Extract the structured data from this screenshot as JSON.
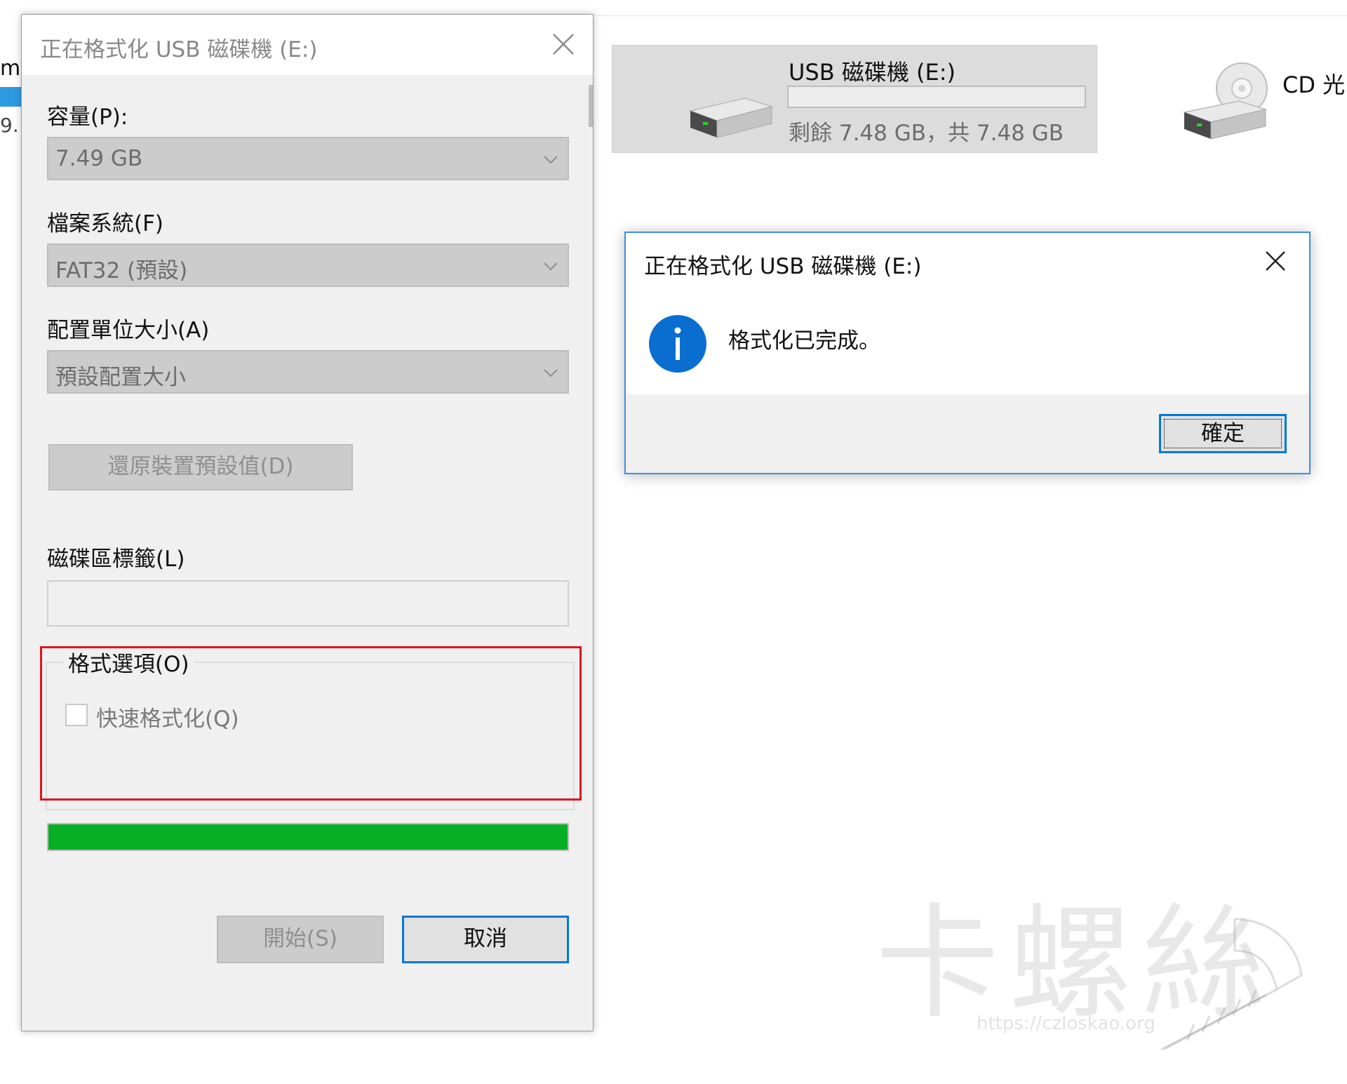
{
  "explorer": {
    "left_fragment_top": "m",
    "left_fragment_bottom": "9.",
    "usb_drive": {
      "name": "USB 磁碟機 (E:)",
      "space_text": "剩餘 7.48 GB，共 7.48 GB",
      "used_fraction": 0.0
    },
    "cd_drive": {
      "name": "CD 光"
    }
  },
  "format_dialog": {
    "title": "正在格式化 USB 磁碟機 (E:)",
    "capacity_label": "容量(P):",
    "capacity_value": "7.49 GB",
    "filesystem_label": "檔案系統(F)",
    "filesystem_value": "FAT32 (預設)",
    "allocation_label": "配置單位大小(A)",
    "allocation_value": "預設配置大小",
    "restore_button": "還原裝置預設值(D)",
    "volume_label": "磁碟區標籤(L)",
    "volume_value": "",
    "format_options_label": "格式選項(O)",
    "quick_format_label": "快速格式化(Q)",
    "quick_format_checked": false,
    "progress_percent": 100,
    "start_button": "開始(S)",
    "cancel_button": "取消"
  },
  "message_box": {
    "title": "正在格式化 USB 磁碟機 (E:)",
    "icon": "info-icon",
    "message": "格式化已完成。",
    "ok_button": "確定"
  },
  "watermark": {
    "text": "卡螺絲",
    "url": "https://czloskao.org"
  },
  "colors": {
    "progress_green": "#06b025",
    "focus_blue": "#0078d7",
    "highlight_red": "#e0141e",
    "info_blue": "#0a6ed1"
  }
}
